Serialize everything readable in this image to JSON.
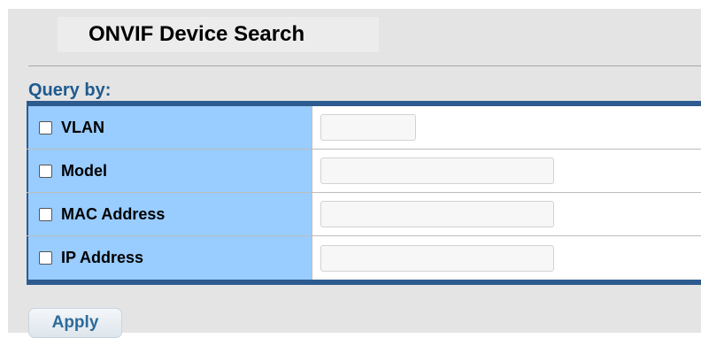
{
  "page": {
    "title": "ONVIF Device Search"
  },
  "query": {
    "section_label": "Query by:",
    "rows": [
      {
        "label": "VLAN",
        "checked": false,
        "value": ""
      },
      {
        "label": "Model",
        "checked": false,
        "value": ""
      },
      {
        "label": "MAC Address",
        "checked": false,
        "value": ""
      },
      {
        "label": "IP Address",
        "checked": false,
        "value": ""
      }
    ]
  },
  "actions": {
    "apply_label": "Apply"
  },
  "colors": {
    "label_cell_background": "#99ccff",
    "table_border": "#2d5b8f",
    "section_label_text": "#1e5a8e",
    "apply_text": "#2d6b9a"
  }
}
